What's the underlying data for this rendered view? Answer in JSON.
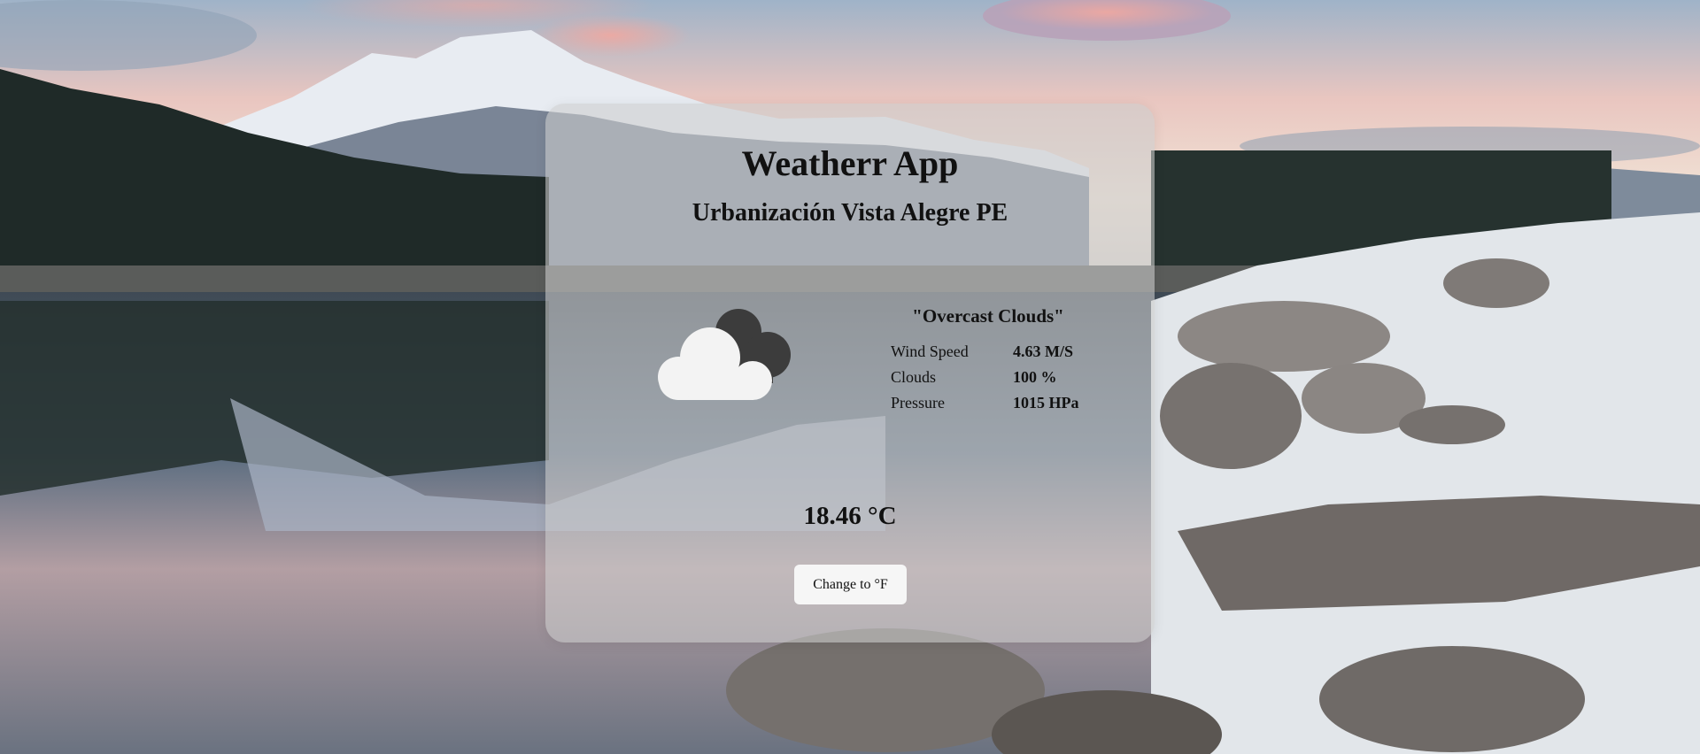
{
  "app": {
    "title": "Weatherr App"
  },
  "location": {
    "name": "Urbanización Vista Alegre PE"
  },
  "weather": {
    "description": "\"Overcast Clouds\"",
    "icon": "overcast-clouds-icon",
    "details": [
      {
        "label": "Wind Speed",
        "value": "4.63 M/S"
      },
      {
        "label": "Clouds",
        "value": "100 %"
      },
      {
        "label": "Pressure",
        "value": "1015 HPa"
      }
    ],
    "temperature": "18.46 °C"
  },
  "controls": {
    "unit_toggle_label": "Change to °F"
  },
  "colors": {
    "card_background": "#cdcdcd",
    "cloud_front": "#f3f3f3",
    "cloud_back": "#3c3c3c",
    "button_background": "#f6f6f6",
    "text": "#111111"
  }
}
